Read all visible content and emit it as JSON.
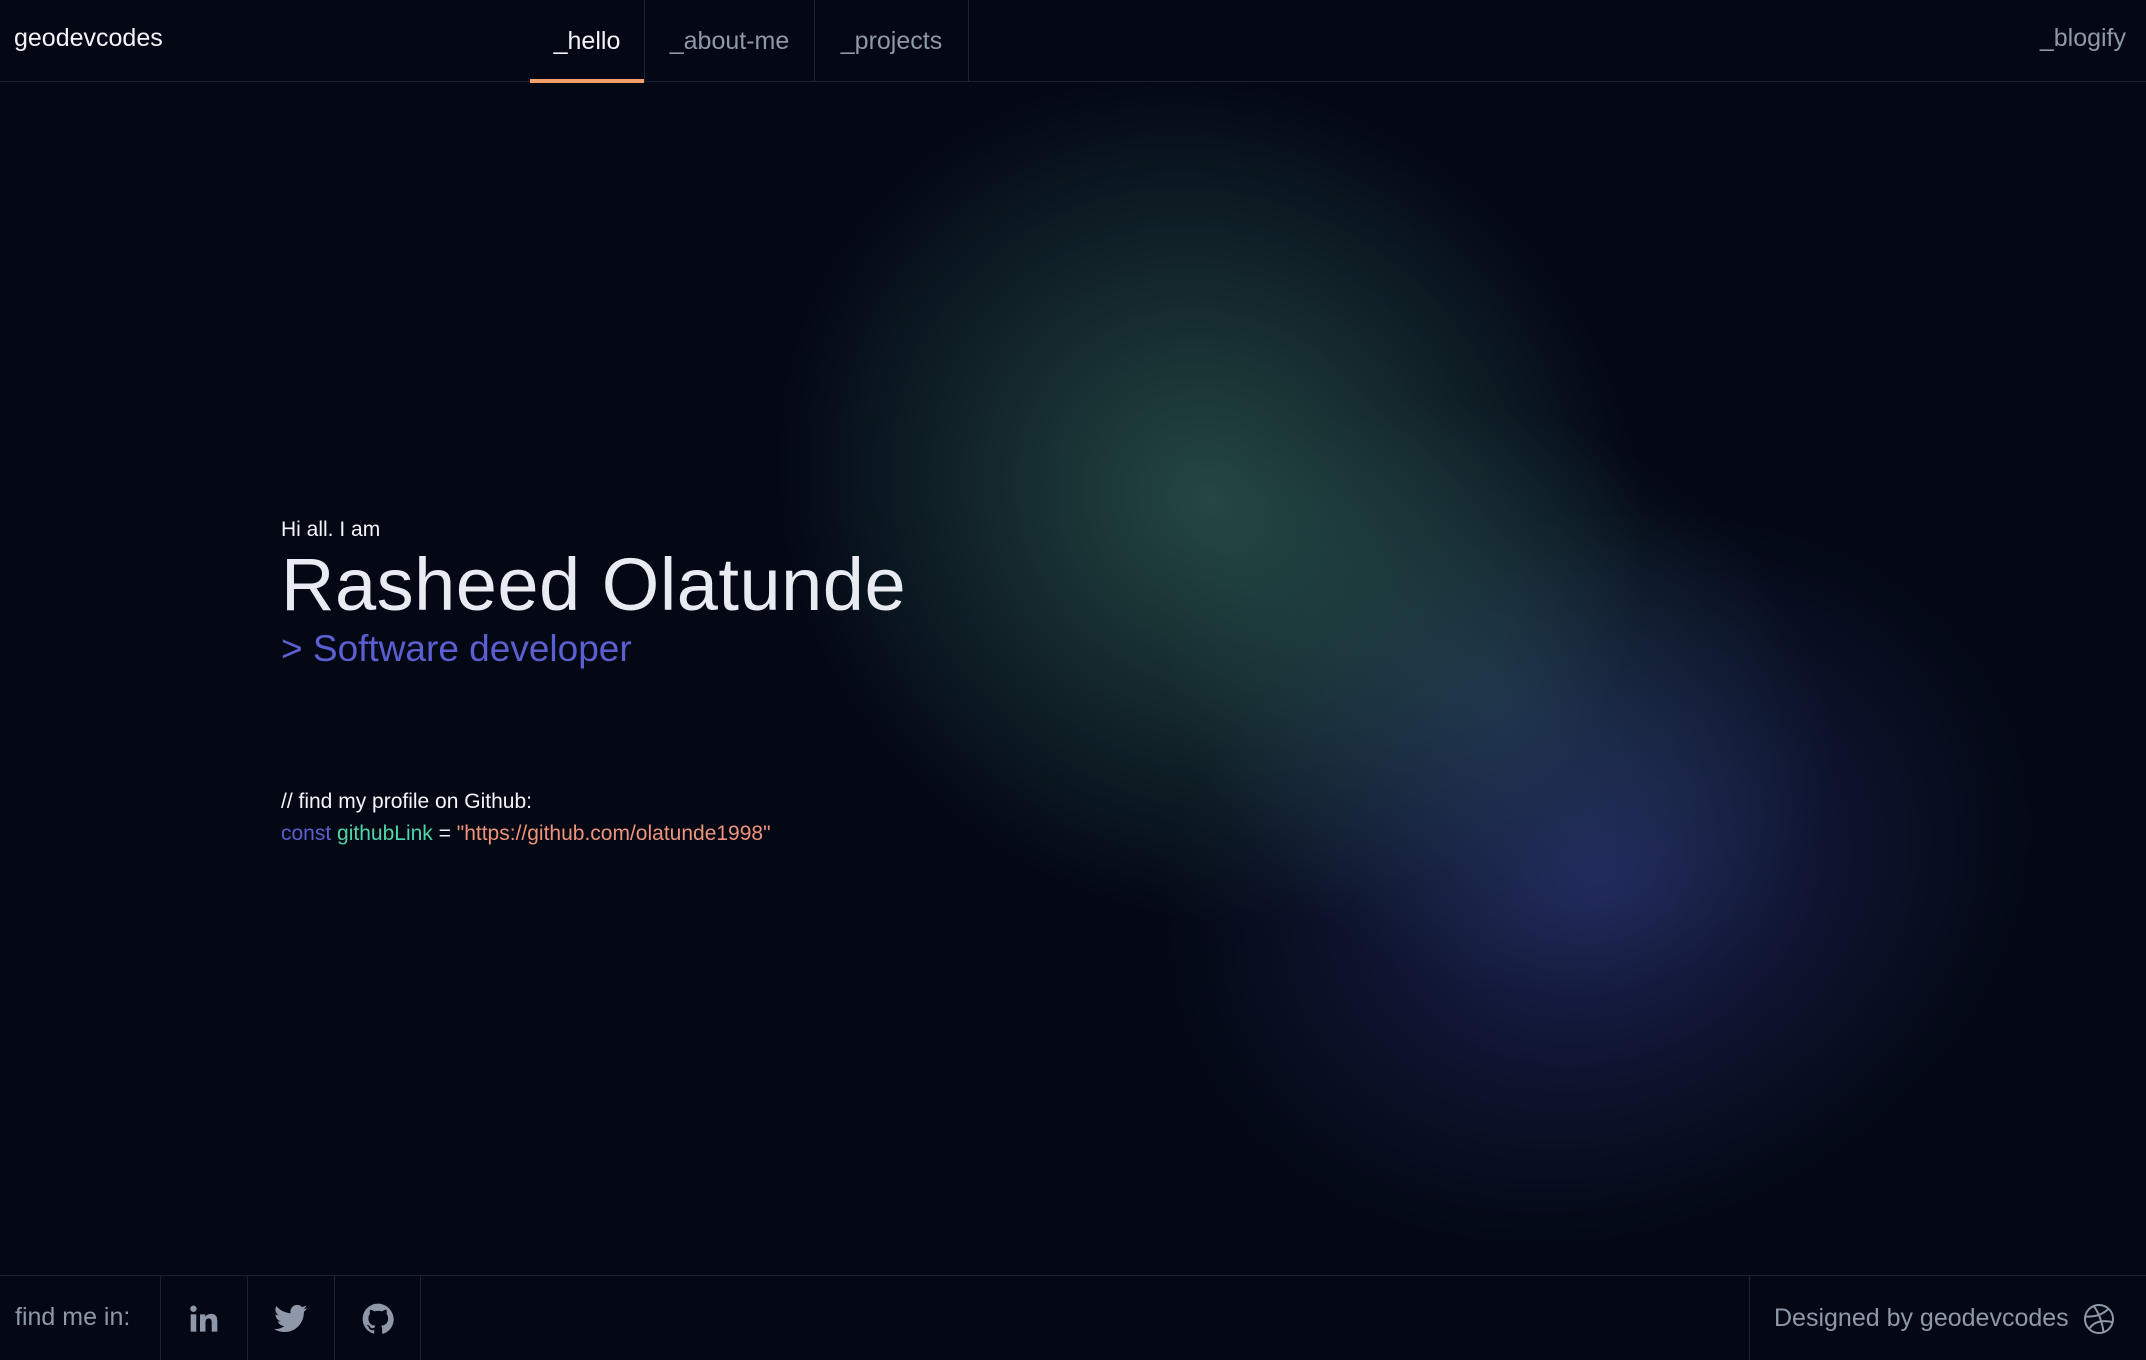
{
  "header": {
    "brand": "geodevcodes",
    "tabs": [
      {
        "label": "_hello",
        "active": true
      },
      {
        "label": "_about-me",
        "active": false
      },
      {
        "label": "_projects",
        "active": false
      }
    ],
    "right_link": "_blogify"
  },
  "hero": {
    "greeting": "Hi all. I am",
    "name": "Rasheed Olatunde",
    "role": "> Software developer"
  },
  "code": {
    "comment": "// find my profile on Github:",
    "keyword": "const",
    "variable": "githubLink",
    "operator": "=",
    "value": "\"https://github.com/olatunde1998\""
  },
  "footer": {
    "find_label": "find me in:",
    "socials": [
      "linkedin-icon",
      "twitter-icon",
      "github-icon"
    ],
    "designed_by": "Designed by geodevcodes",
    "designed_icon": "dribbble-icon"
  },
  "colors": {
    "background": "#030814",
    "accent_orange": "#f3a06b",
    "accent_purple": "#5b5fd1",
    "accent_green": "#4fd6a8",
    "accent_salmon": "#f0937a",
    "muted_text": "#8f98a9"
  }
}
